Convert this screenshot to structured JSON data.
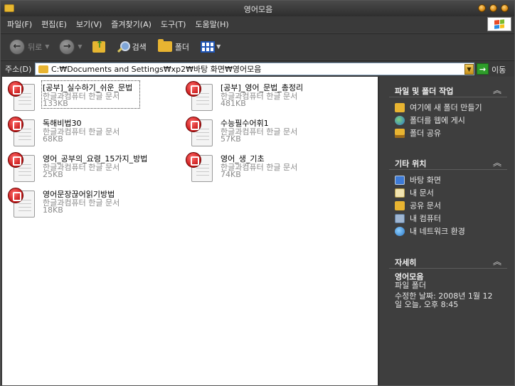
{
  "window": {
    "title": "영어모음"
  },
  "menu": [
    "파일(F)",
    "편집(E)",
    "보기(V)",
    "즐겨찾기(A)",
    "도구(T)",
    "도움말(H)"
  ],
  "toolbar": {
    "back_label": "뒤로",
    "search_label": "검색",
    "folders_label": "폴더"
  },
  "address": {
    "label": "주소(D)",
    "path": "C:₩Documents and Settings₩xp2₩바탕 화면₩영어모음",
    "go_label": "이동"
  },
  "files": [
    {
      "name": "[공부]_실수하기_쉬운_문법",
      "type": "한글과컴퓨터 한글 문서",
      "size": "133KB"
    },
    {
      "name": "[공부]_영어_문법_총정리",
      "type": "한글과컴퓨터 한글 문서",
      "size": "481KB"
    },
    {
      "name": "독해비법30",
      "type": "한글과컴퓨터 한글 문서",
      "size": "68KB"
    },
    {
      "name": "수능필수어휘1",
      "type": "한글과컴퓨터 한글 문서",
      "size": "57KB"
    },
    {
      "name": "영어_공부의_요령_15가지_방법",
      "type": "한글과컴퓨터 한글 문서",
      "size": "25KB"
    },
    {
      "name": "영어_생_기초",
      "type": "한글과컴퓨터 한글 문서",
      "size": "74KB"
    },
    {
      "name": "영어문장끊어읽기방법",
      "type": "한글과컴퓨터 한글 문서",
      "size": "18KB"
    }
  ],
  "side": {
    "tasks": {
      "title": "파일 및 폴더 작업",
      "items": [
        "여기에 새 폴더 만들기",
        "폴더를 웹에 게시",
        "폴더 공유"
      ]
    },
    "places": {
      "title": "기타 위치",
      "items": [
        "바탕 화면",
        "내 문서",
        "공유 문서",
        "내 컴퓨터",
        "내 네트워크 환경"
      ]
    },
    "details": {
      "title": "자세히",
      "name": "영어모음",
      "kind": "파일 폴더",
      "modified_line1": "수정한 날짜: 2008년 1월 12",
      "modified_line2": "일 오늘, 오후 8:45"
    }
  }
}
